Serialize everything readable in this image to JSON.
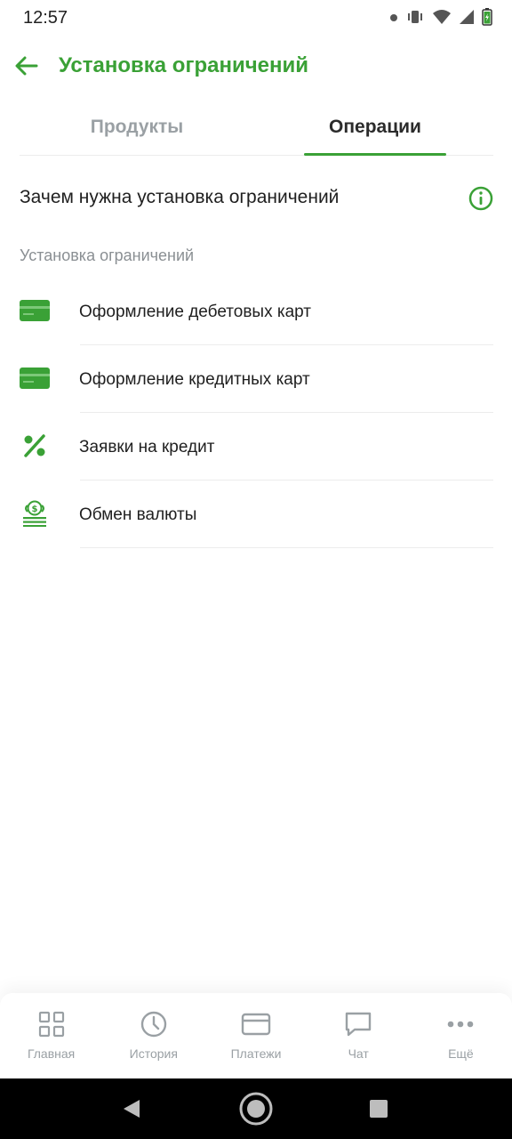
{
  "status_bar": {
    "time": "12:57"
  },
  "header": {
    "title": "Установка ограничений"
  },
  "tabs": [
    {
      "label": "Продукты",
      "active": false
    },
    {
      "label": "Операции",
      "active": true
    }
  ],
  "info": {
    "text": "Зачем нужна установка ограничений",
    "icon": "info-icon"
  },
  "section": {
    "label": "Установка ограничений"
  },
  "items": [
    {
      "label": "Оформление дебетовых карт",
      "icon": "card-icon"
    },
    {
      "label": "Оформление кредитных карт",
      "icon": "card-icon"
    },
    {
      "label": "Заявки на кредит",
      "icon": "percent-icon"
    },
    {
      "label": "Обмен валюты",
      "icon": "currency-exchange-icon"
    }
  ],
  "bottom_nav": [
    {
      "label": "Главная",
      "icon": "grid-icon"
    },
    {
      "label": "История",
      "icon": "clock-icon"
    },
    {
      "label": "Платежи",
      "icon": "card-outline-icon"
    },
    {
      "label": "Чат",
      "icon": "chat-icon"
    },
    {
      "label": "Ещё",
      "icon": "more-icon"
    }
  ],
  "colors": {
    "accent": "#3aa136",
    "muted": "#9aa0a4",
    "text": "#1f1f1f"
  }
}
